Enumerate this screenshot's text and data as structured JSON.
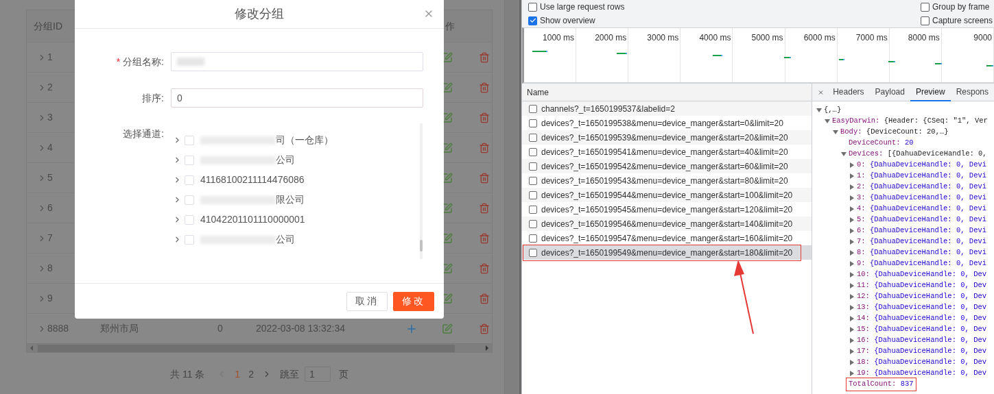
{
  "group_page": {
    "table": {
      "columns": [
        "分组ID",
        "作"
      ],
      "rows": [
        {
          "id": "1"
        },
        {
          "id": "2"
        },
        {
          "id": "3"
        },
        {
          "id": "4"
        },
        {
          "id": "5"
        },
        {
          "id": "6"
        },
        {
          "id": "7"
        },
        {
          "id": "8"
        },
        {
          "id": "9"
        },
        {
          "id": "8888",
          "cells": [
            "郑州市局",
            "0",
            "2022-03-08 13:32:34"
          ]
        }
      ]
    },
    "pagination": {
      "total": "共 11 条",
      "pages": [
        {
          "label": "1",
          "selected": true
        },
        {
          "label": "2",
          "selected": false
        }
      ],
      "jump_label": "跳至",
      "jump_value": "1",
      "unit": "页"
    }
  },
  "dialog": {
    "title": "修改分组",
    "name_field": {
      "required_mark": "*",
      "label": "分组名称:",
      "redacted": true
    },
    "sort_field": {
      "label": "排序:",
      "value": "0"
    },
    "channel_label": "选择通道:",
    "channels": [
      {
        "label": "司（一仓库）",
        "redacted": true,
        "checked": false
      },
      {
        "label": "公司",
        "redacted": true,
        "checked": false
      },
      {
        "label": "41168100211114476086",
        "redacted": false,
        "checked": false
      },
      {
        "label": "限公司",
        "redacted": true,
        "checked": false
      },
      {
        "label": "41042201101110000001",
        "redacted": false,
        "checked": false
      },
      {
        "label": "公司",
        "redacted": true,
        "checked": false
      }
    ],
    "buttons": [
      {
        "label": "取消",
        "kind": "secondary"
      },
      {
        "label": "修改",
        "kind": "primary"
      }
    ]
  },
  "devtools": {
    "settings": [
      {
        "label": "Use large request rows",
        "checked": false
      },
      {
        "label": "Group by frame",
        "checked": false
      },
      {
        "label": "Show overview",
        "checked": true
      },
      {
        "label": "Capture screens",
        "checked": false
      }
    ],
    "overview_ticks": [
      "1000 ms",
      "2000 ms",
      "3000 ms",
      "4000 ms",
      "5000 ms",
      "6000 ms",
      "7000 ms",
      "8000 ms",
      "9000"
    ],
    "requests": {
      "column": "Name",
      "rows": [
        {
          "name": "channels?_t=1650199537&labelid=2",
          "checked": false,
          "selected": false
        },
        {
          "name": "devices?_t=1650199538&menu=device_manger&start=0&limit=20",
          "checked": false,
          "selected": false
        },
        {
          "name": "devices?_t=1650199539&menu=device_manger&start=20&limit=20",
          "checked": false,
          "selected": false
        },
        {
          "name": "devices?_t=1650199541&menu=device_manger&start=40&limit=20",
          "checked": false,
          "selected": false
        },
        {
          "name": "devices?_t=1650199542&menu=device_manger&start=60&limit=20",
          "checked": false,
          "selected": false
        },
        {
          "name": "devices?_t=1650199543&menu=device_manger&start=80&limit=20",
          "checked": false,
          "selected": false
        },
        {
          "name": "devices?_t=1650199544&menu=device_manger&start=100&limit=20",
          "checked": false,
          "selected": false
        },
        {
          "name": "devices?_t=1650199545&menu=device_manger&start=120&limit=20",
          "checked": false,
          "selected": false
        },
        {
          "name": "devices?_t=1650199546&menu=device_manger&start=140&limit=20",
          "checked": false,
          "selected": false
        },
        {
          "name": "devices?_t=1650199547&menu=device_manger&start=160&limit=20",
          "checked": false,
          "selected": false
        },
        {
          "name": "devices?_t=1650199549&menu=device_manger&start=180&limit=20",
          "checked": false,
          "selected": true
        }
      ]
    },
    "detail_tabs": [
      {
        "label": "Headers",
        "selected": false
      },
      {
        "label": "Payload",
        "selected": false
      },
      {
        "label": "Preview",
        "selected": true
      },
      {
        "label": "Respons",
        "selected": false
      }
    ],
    "preview": [
      {
        "value": "{,…}",
        "expanded": true,
        "children": [
          {
            "key": "EasyDarwin:",
            "value": "{Header: {CSeq: \"1\", Ver",
            "expanded": true,
            "children": [
              {
                "key": "Body:",
                "value": "{DeviceCount: 20,…}",
                "expanded": true,
                "children": [
                  {
                    "key": "DeviceCount:",
                    "value": "20",
                    "highlighted": false
                  },
                  {
                    "key": "Devices:",
                    "value": "[{DahuaDeviceHandle: 0,",
                    "expanded": true,
                    "highlighted": false,
                    "children": [
                      {
                        "key": "0:",
                        "value": "{DahuaDeviceHandle: 0, Devi",
                        "expanded": false
                      },
                      {
                        "key": "1:",
                        "value": "{DahuaDeviceHandle: 0, Devi",
                        "expanded": false
                      },
                      {
                        "key": "2:",
                        "value": "{DahuaDeviceHandle: 0, Devi",
                        "expanded": false
                      },
                      {
                        "key": "3:",
                        "value": "{DahuaDeviceHandle: 0, Devi",
                        "expanded": false
                      },
                      {
                        "key": "4:",
                        "value": "{DahuaDeviceHandle: 0, Devi",
                        "expanded": false
                      },
                      {
                        "key": "5:",
                        "value": "{DahuaDeviceHandle: 0, Devi",
                        "expanded": false
                      },
                      {
                        "key": "6:",
                        "value": "{DahuaDeviceHandle: 0, Devi",
                        "expanded": false
                      },
                      {
                        "key": "7:",
                        "value": "{DahuaDeviceHandle: 0, Devi",
                        "expanded": false
                      },
                      {
                        "key": "8:",
                        "value": "{DahuaDeviceHandle: 0, Devi",
                        "expanded": false
                      },
                      {
                        "key": "9:",
                        "value": "{DahuaDeviceHandle: 0, Devi",
                        "expanded": false
                      },
                      {
                        "key": "10:",
                        "value": "{DahuaDeviceHandle: 0, Dev",
                        "expanded": false
                      },
                      {
                        "key": "11:",
                        "value": "{DahuaDeviceHandle: 0, Dev",
                        "expanded": false
                      },
                      {
                        "key": "12:",
                        "value": "{DahuaDeviceHandle: 0, Dev",
                        "expanded": false
                      },
                      {
                        "key": "13:",
                        "value": "{DahuaDeviceHandle: 0, Dev",
                        "expanded": false
                      },
                      {
                        "key": "14:",
                        "value": "{DahuaDeviceHandle: 0, Dev",
                        "expanded": false
                      },
                      {
                        "key": "15:",
                        "value": "{DahuaDeviceHandle: 0, Dev",
                        "expanded": false
                      },
                      {
                        "key": "16:",
                        "value": "{DahuaDeviceHandle: 0, Dev",
                        "expanded": false
                      },
                      {
                        "key": "17:",
                        "value": "{DahuaDeviceHandle: 0, Dev",
                        "expanded": false
                      },
                      {
                        "key": "18:",
                        "value": "{DahuaDeviceHandle: 0, Dev",
                        "expanded": false
                      },
                      {
                        "key": "19:",
                        "value": "{DahuaDeviceHandle: 0, Dev",
                        "expanded": false
                      }
                    ]
                  },
                  {
                    "key": "TotalCount:",
                    "value": "837",
                    "highlighted": true
                  }
                ]
              }
            ]
          }
        ]
      }
    ]
  }
}
